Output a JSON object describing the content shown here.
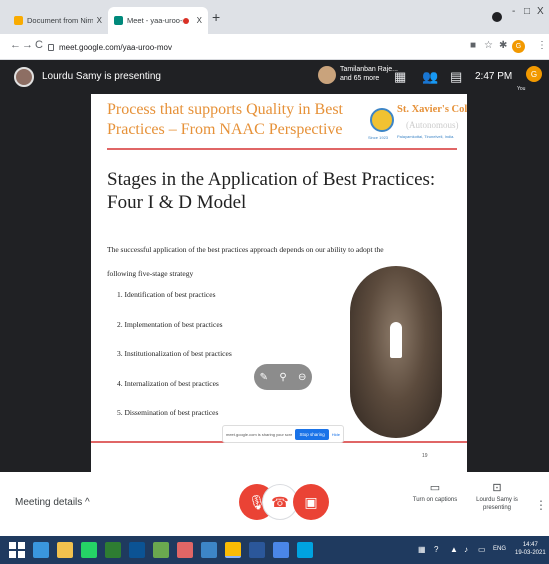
{
  "browser": {
    "tabs": [
      {
        "title": "Document from Nirmala - gogu",
        "close": "X"
      },
      {
        "title": "Meet - yaa-uroo-mov",
        "close": "X"
      }
    ],
    "new_tab": "+",
    "window_controls": [
      "-",
      "□",
      "X"
    ],
    "nav": [
      "←",
      "→",
      "C"
    ],
    "url": "meet.google.com/yaa-uroo-mov",
    "profile_initial": "G",
    "toolbar_icons": [
      "key-icon",
      "star-icon",
      "extensions-icon",
      "more-icon"
    ]
  },
  "meet": {
    "presenter_text": "Lourdu Samy is presenting",
    "participant_line1": "Tamilanban Raje...",
    "participant_line2": "and 65 more",
    "time": "2:47 PM",
    "self_initial": "G",
    "self_label": "You",
    "icons": [
      "grid-layout-icon",
      "people-icon",
      "chat-icon"
    ]
  },
  "slide": {
    "header_title": "Process that supports Quality in Best Practices – From NAAC Perspective",
    "logo_name": "St. Xavier's College",
    "logo_autonomous": "(Autonomous)",
    "logo_location": "Palayamkottai, Tirunelveli, India.",
    "logo_since": "Since 1923",
    "title": "Stages in the Application of Best Practices: Four I & D Model",
    "intro": "The successful application of the best practices approach depends on our ability to adopt the following five-stage strategy",
    "steps": [
      "1.   Identification of best practices",
      "2.   Implementation of best practices",
      "3.   Institutionalization of best practices",
      "4.   Internalization of best practices",
      "5.   Dissemination of best practices"
    ],
    "page_number": "19"
  },
  "share_notice": {
    "text": "meet.google.com is sharing your screen.",
    "stop_label": "Stop sharing",
    "hide_label": "Hide"
  },
  "controls": {
    "meeting_details": "Meeting details",
    "captions_label": "Turn on captions",
    "presenting_label": "Lourdu Samy is presenting"
  },
  "taskbar": {
    "tray_lang": "ENG",
    "clock_time": "14:47",
    "clock_date": "19-03-2021"
  }
}
